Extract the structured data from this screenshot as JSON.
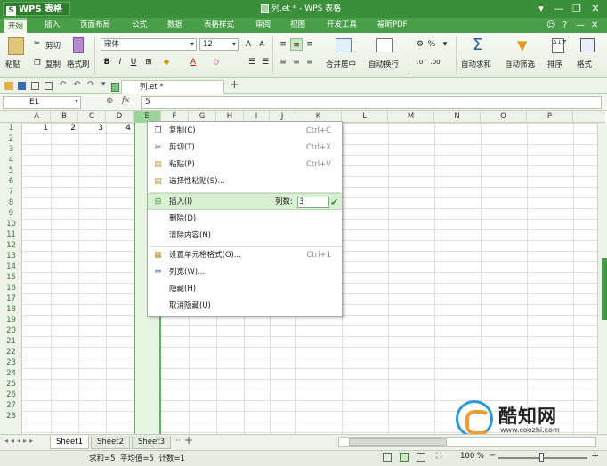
{
  "titlebar": {
    "app": "WPS 表格",
    "app_letter": "S",
    "title": "列.et * - WPS 表格",
    "winbtns": [
      "▾",
      "—",
      "❐",
      "✕"
    ]
  },
  "menubar": {
    "items": [
      "开始",
      "插入",
      "页面布局",
      "公式",
      "数据",
      "表格样式",
      "审阅",
      "视图",
      "开发工具",
      "福昕PDF"
    ],
    "right": [
      "☺",
      "?",
      "—",
      "✕"
    ]
  },
  "ribbon": {
    "paste": "粘贴",
    "cut": "剪切",
    "copy": "复制",
    "format_painter": "格式刷",
    "font": "宋体",
    "size": "12",
    "bold": "B",
    "italic": "I",
    "underline": "U",
    "merge_center": "合并居中",
    "wrap": "自动换行",
    "percent": "%",
    "autosum": "自动求和",
    "autofilter": "自动筛选",
    "sort": "排序",
    "format": "格式"
  },
  "tabstrip": {
    "file": "列.et *",
    "new_tab": "+"
  },
  "formula": {
    "name_box": "E1",
    "fx": "fx",
    "value": "5"
  },
  "grid": {
    "columns": [
      "A",
      "B",
      "C",
      "D",
      "E",
      "F",
      "G",
      "H",
      "I",
      "J",
      "K",
      "L",
      "M",
      "N",
      "O",
      "P"
    ],
    "selected_column": "E",
    "rows": [
      "1",
      "2",
      "3",
      "4",
      "5",
      "6",
      "7",
      "8",
      "9",
      "10",
      "11",
      "12",
      "13",
      "14",
      "15",
      "16",
      "17",
      "18",
      "19",
      "20",
      "21",
      "22",
      "23",
      "24",
      "25",
      "26",
      "27",
      "28"
    ],
    "row1_values": [
      "1",
      "2",
      "3",
      "4"
    ]
  },
  "context_menu": {
    "items": [
      {
        "label": "复制(C)",
        "shortcut": "Ctrl+C",
        "icon": "copy-icon"
      },
      {
        "label": "剪切(T)",
        "shortcut": "Ctrl+X",
        "icon": "scissors-icon"
      },
      {
        "label": "粘贴(P)",
        "shortcut": "Ctrl+V",
        "icon": "paste-icon"
      },
      {
        "label": "选择性粘贴(S)...",
        "shortcut": "",
        "icon": "paste-special-icon"
      },
      {
        "label": "插入(I)",
        "shortcut": "",
        "icon": "insert-column-icon"
      },
      {
        "label": "删除(D)",
        "shortcut": "",
        "icon": ""
      },
      {
        "label": "清除内容(N)",
        "shortcut": "",
        "icon": ""
      },
      {
        "label": "设置单元格格式(O)...",
        "shortcut": "Ctrl+1",
        "icon": "format-cells-icon"
      },
      {
        "label": "列宽(W)...",
        "shortcut": "",
        "icon": "column-width-icon"
      },
      {
        "label": "隐藏(H)",
        "shortcut": "",
        "icon": ""
      },
      {
        "label": "取消隐藏(U)",
        "shortcut": "",
        "icon": ""
      }
    ],
    "count_label": "列数:",
    "count_value": "3"
  },
  "sheets": {
    "tabs": [
      "Sheet1",
      "Sheet2",
      "Sheet3"
    ],
    "active": "Sheet1",
    "more": "···",
    "add": "+"
  },
  "status": {
    "text": "求和=5  平均值=5  计数=1",
    "zoom": "100 %"
  },
  "watermark": {
    "name": "酷知网",
    "url": "www.coozhi.com"
  },
  "colors": {
    "brand": "#3b8f3b",
    "selection": "#5fb25f",
    "menu_highlight": "#d9f0d3"
  }
}
